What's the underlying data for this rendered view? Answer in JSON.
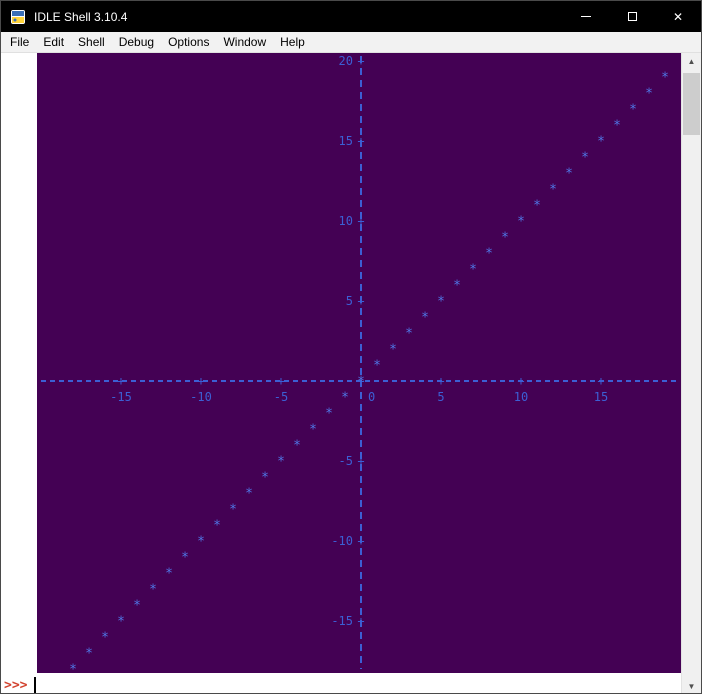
{
  "window": {
    "title": "IDLE Shell 3.10.4",
    "controls": {
      "close_glyph": "✕"
    }
  },
  "menu": {
    "items": [
      "File",
      "Edit",
      "Shell",
      "Debug",
      "Options",
      "Window",
      "Help"
    ]
  },
  "shell": {
    "prompt": ">>>",
    "prompt_color": "#d2432f"
  },
  "scrollbar": {
    "up_glyph": "▲",
    "down_glyph": "▼"
  },
  "chart_data": {
    "type": "scatter",
    "title": "",
    "marker": "*",
    "tick_glyph": "+",
    "x": [
      -18,
      -17,
      -16,
      -15,
      -14,
      -13,
      -12,
      -11,
      -10,
      -9,
      -8,
      -7,
      -6,
      -5,
      -4,
      -3,
      -2,
      -1,
      0,
      1,
      2,
      3,
      4,
      5,
      6,
      7,
      8,
      9,
      10,
      11,
      12,
      13,
      14,
      15,
      16,
      17,
      18,
      19
    ],
    "y": [
      -18,
      -17,
      -16,
      -15,
      -14,
      -13,
      -12,
      -11,
      -10,
      -9,
      -8,
      -7,
      -6,
      -5,
      -4,
      -3,
      -2,
      -1,
      0,
      1,
      2,
      3,
      4,
      5,
      6,
      7,
      8,
      9,
      10,
      11,
      12,
      13,
      14,
      15,
      16,
      17,
      18,
      19
    ],
    "x_ticks": [
      -15,
      -10,
      -5,
      0,
      5,
      10,
      15
    ],
    "y_ticks": [
      20,
      15,
      10,
      5,
      -5,
      -10,
      -15
    ],
    "xlim": [
      -20,
      20
    ],
    "ylim": [
      -18,
      20.5
    ],
    "origin_label": "0",
    "background": "#440154",
    "axis_color": "#3c5fd4",
    "point_color": "#4f77e6",
    "grid": false,
    "legend": "none"
  }
}
